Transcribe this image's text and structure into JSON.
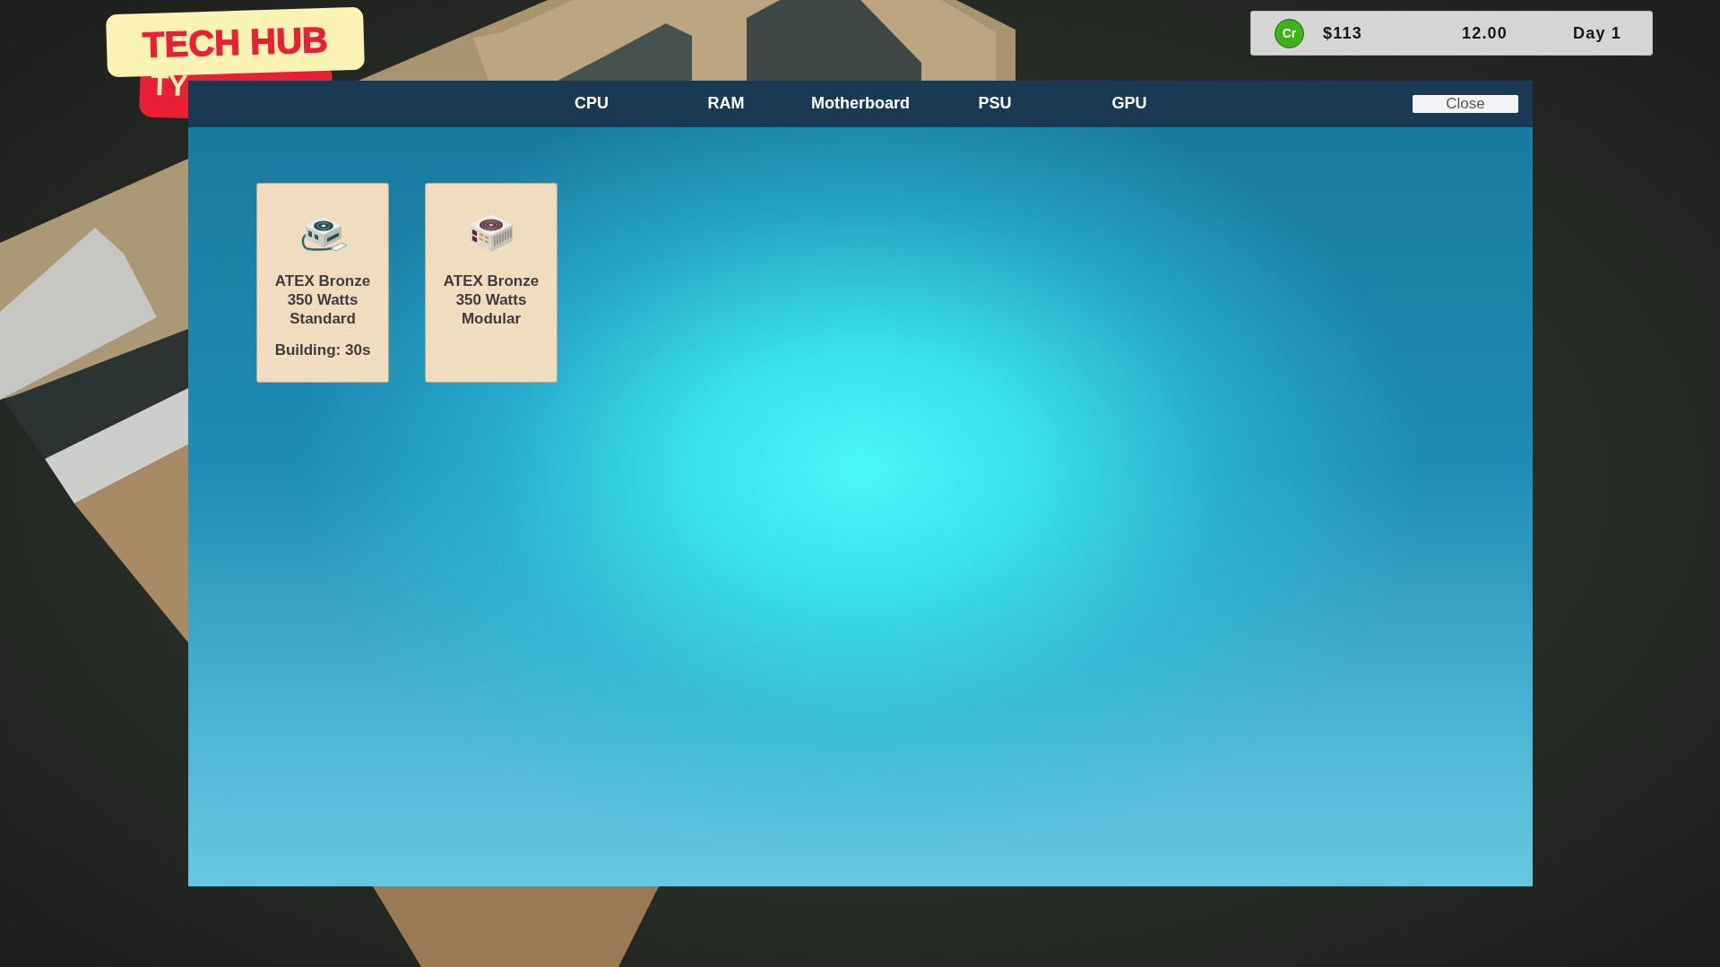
{
  "logo": {
    "title": "TECH HUB",
    "tag": "TY"
  },
  "status_bar": {
    "currency": "Cr",
    "money": "$113",
    "time": "12.00",
    "day": "Day 1"
  },
  "shop_window": {
    "tabs": [
      {
        "label": "CPU"
      },
      {
        "label": "RAM"
      },
      {
        "label": "Motherboard"
      },
      {
        "label": "PSU"
      },
      {
        "label": "GPU"
      }
    ],
    "close_button": "Close",
    "items": [
      {
        "kind": "standard",
        "name": "ATEX Bronze 350 Watts Standard",
        "status": "Building: 30s"
      },
      {
        "kind": "modular",
        "name": "ATEX Bronze 350 Watts Modular"
      }
    ]
  }
}
